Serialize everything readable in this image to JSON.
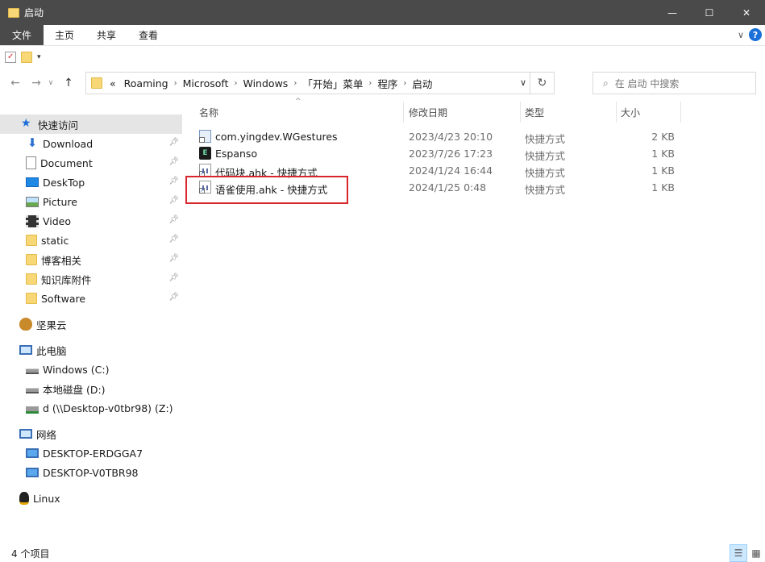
{
  "window": {
    "title": "启动",
    "minimize_glyph": "—",
    "maximize_glyph": "☐",
    "close_glyph": "✕"
  },
  "ribbon": {
    "tabs": [
      "文件",
      "主页",
      "共享",
      "查看"
    ],
    "expand_glyph": "∨",
    "help_glyph": "?"
  },
  "address": {
    "overflow": "«",
    "crumbs": [
      "Roaming",
      "Microsoft",
      "Windows",
      "「开始」菜单",
      "程序",
      "启动"
    ],
    "separator": "›",
    "dropdown_glyph": "∨",
    "refresh_glyph": "↻"
  },
  "search": {
    "placeholder": "在 启动 中搜索"
  },
  "nav": {
    "quick_access": "快速访问",
    "items": [
      {
        "label": "Download",
        "icon": "download-icon",
        "pinned": true
      },
      {
        "label": "Document",
        "icon": "document-icon",
        "pinned": true
      },
      {
        "label": "DeskTop",
        "icon": "desktop-icon",
        "pinned": true
      },
      {
        "label": "Picture",
        "icon": "picture-icon",
        "pinned": true
      },
      {
        "label": "Video",
        "icon": "video-icon",
        "pinned": true
      },
      {
        "label": "static",
        "icon": "folder-icon",
        "pinned": true
      },
      {
        "label": "博客相关",
        "icon": "folder-icon",
        "pinned": true
      },
      {
        "label": "知识库附件",
        "icon": "folder-icon",
        "pinned": true
      },
      {
        "label": "Software",
        "icon": "folder-icon",
        "pinned": true
      }
    ],
    "jianguoyun": "坚果云",
    "this_pc": "此电脑",
    "drives": [
      "Windows (C:)",
      "本地磁盘 (D:)",
      "d (\\\\Desktop-v0tbr98) (Z:)"
    ],
    "network": "网络",
    "computers": [
      "DESKTOP-ERDGGA7",
      "DESKTOP-V0TBR98"
    ],
    "linux": "Linux"
  },
  "columns": {
    "name": "名称",
    "date": "修改日期",
    "type": "类型",
    "size": "大小"
  },
  "files": [
    {
      "name": "com.yingdev.WGestures",
      "date": "2023/4/23 20:10",
      "type": "快捷方式",
      "size": "2 KB",
      "icon": "wgestures-icon"
    },
    {
      "name": "Espanso",
      "date": "2023/7/26 17:23",
      "type": "快捷方式",
      "size": "1 KB",
      "icon": "espanso-icon"
    },
    {
      "name": "代码块.ahk - 快捷方式",
      "date": "2024/1/24 16:44",
      "type": "快捷方式",
      "size": "1 KB",
      "icon": "ahk-shortcut-icon"
    },
    {
      "name": "语雀使用.ahk - 快捷方式",
      "date": "2024/1/25 0:48",
      "type": "快捷方式",
      "size": "1 KB",
      "icon": "ahk-shortcut-icon"
    }
  ],
  "status": {
    "count": "4 个项目"
  },
  "colors": {
    "titlebar": "#4a4a4a",
    "selection": "#e5e5e5",
    "highlight_border": "#d9262c",
    "accent": "#1a6fd8"
  }
}
